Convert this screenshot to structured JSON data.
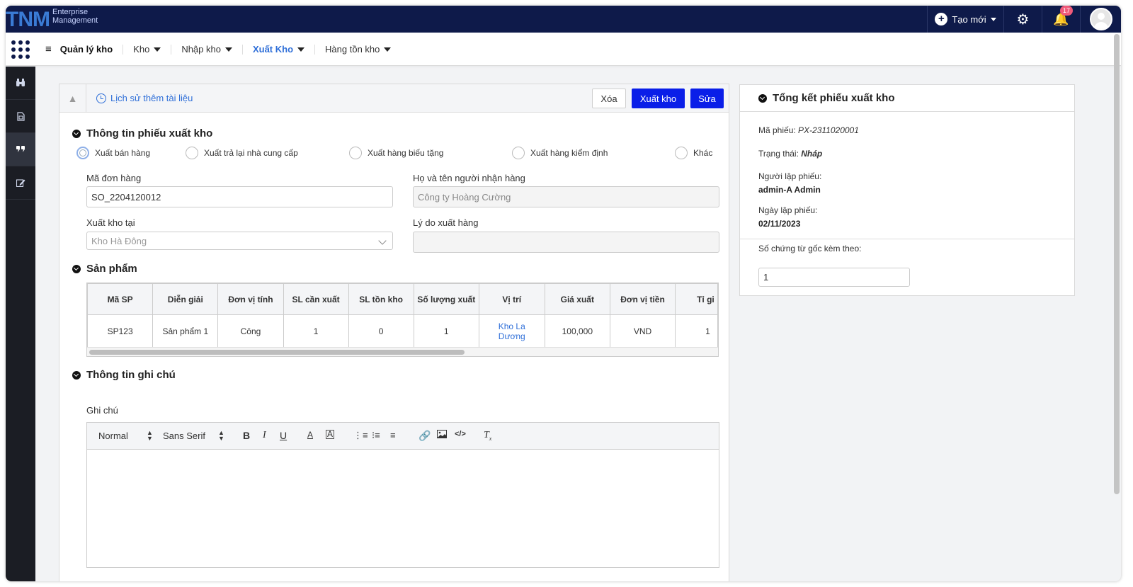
{
  "brand": {
    "logo": "TNM",
    "line1": "Enterprise",
    "line2": "Management"
  },
  "topbar": {
    "create_label": "Tạo mới",
    "notification_count": "17"
  },
  "nav": {
    "title": "Quản lý kho",
    "items": [
      {
        "label": "Kho"
      },
      {
        "label": "Nhập kho"
      },
      {
        "label": "Xuất Kho"
      },
      {
        "label": "Hàng tồn kho"
      }
    ]
  },
  "toolbar": {
    "history_label": "Lịch sử thêm tài liệu",
    "delete_label": "Xóa",
    "export_label": "Xuất kho",
    "edit_label": "Sửa"
  },
  "form": {
    "section_title": "Thông tin phiếu xuất kho",
    "radio_options": [
      "Xuất bán hàng",
      "Xuất trả lại nhà cung cấp",
      "Xuất hàng biếu tặng",
      "Xuất hàng kiểm định",
      "Khác"
    ],
    "selected_option": "Xuất bán hàng",
    "order_code_label": "Mã đơn hàng",
    "order_code_value": "SO_2204120012",
    "receiver_label": "Họ và tên người nhận hàng",
    "receiver_value": "Công ty Hoàng Cường",
    "warehouse_label": "Xuất kho tại",
    "warehouse_value": "Kho Hà Đông",
    "reason_label": "Lý do xuất hàng",
    "reason_value": ""
  },
  "products": {
    "section_title": "Sản phẩm",
    "columns": [
      "Mã SP",
      "Diễn giải",
      "Đơn vị tính",
      "SL cần xuất",
      "SL tồn kho",
      "Số lượng xuất",
      "Vị trí",
      "Giá xuất",
      "Đơn vị tiền",
      "Tỉ gi"
    ],
    "rows": [
      [
        "SP123",
        "Sản phẩm 1",
        "Công",
        "1",
        "0",
        "1",
        "Kho La Dương",
        "100,000",
        "VND",
        "1"
      ]
    ]
  },
  "notes": {
    "section_title": "Thông tin ghi chú",
    "label": "Ghi chú",
    "editor": {
      "format": "Normal",
      "font": "Sans Serif"
    }
  },
  "summary": {
    "title": "Tổng kết phiếu xuất kho",
    "code_label": "Mã phiếu:",
    "code_value": "PX-2311020001",
    "status_label": "Trạng thái:",
    "status_value": "Nháp",
    "creator_label": "Người lập phiếu:",
    "creator_value": "admin-A Admin",
    "date_label": "Ngày lập phiếu:",
    "date_value": "02/11/2023",
    "docs_label": "Số chứng từ gốc kèm theo:",
    "docs_value": "1"
  }
}
